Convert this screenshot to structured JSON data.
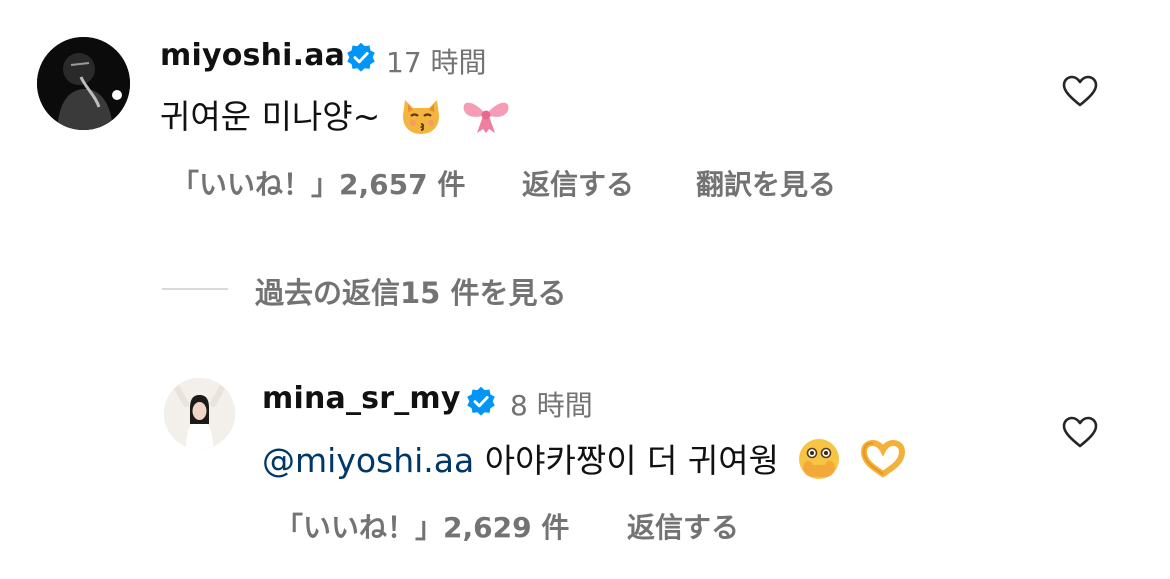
{
  "comments": {
    "main": {
      "username": "miyoshi.aa",
      "time": "17 時間",
      "text": "귀여운 미나양~",
      "likes": "「いいね！」2,657 件",
      "reply": "返信する",
      "translate": "翻訳を見る",
      "emojis": [
        "kissing-cat-icon",
        "ribbon-icon"
      ]
    },
    "view_replies": "過去の返信15 件を見る",
    "reply": {
      "username": "mina_sr_my",
      "time": "8 時間",
      "mention": "@miyoshi.aa",
      "text": "아야카짱이 더 귀여웡",
      "likes": "「いいね！」2,629 件",
      "reply": "返信する",
      "emojis": [
        "face-with-open-eyes-and-hand-over-mouth-icon",
        "heart-hands-icon"
      ]
    }
  },
  "colors": {
    "verified_blue": "#0095f6",
    "muted_text": "#737373",
    "mention_blue": "#00376b",
    "divider": "#d9d9d9"
  }
}
